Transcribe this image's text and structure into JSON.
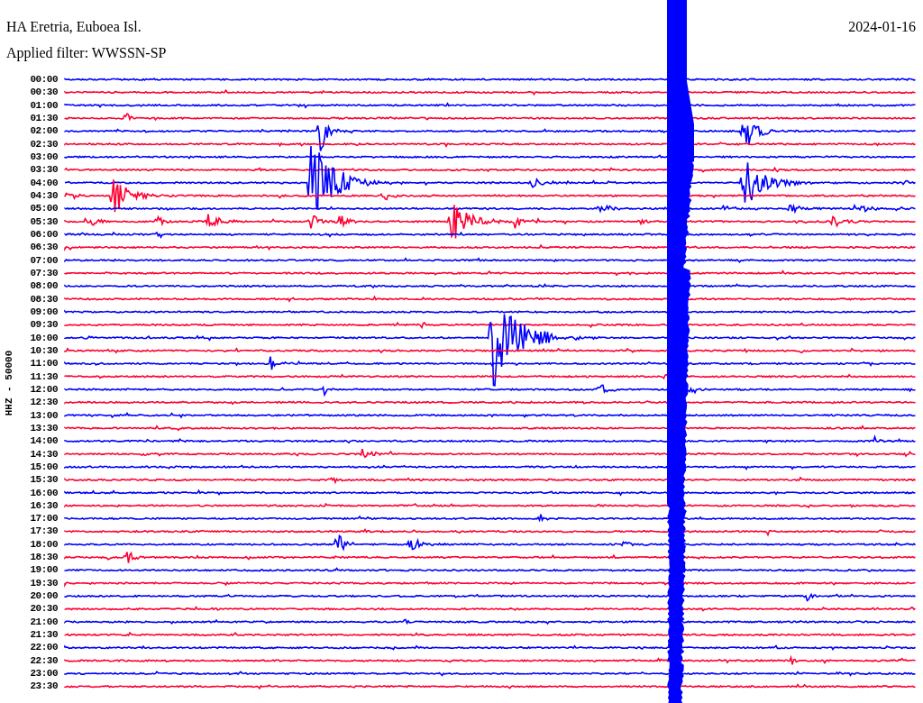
{
  "header": {
    "station": "HA Eretria, Euboea Isl.",
    "date": "2024-01-16",
    "filter": "Applied filter: WWSSN-SP"
  },
  "helicorder": {
    "channel_label": "HHZ - 50000",
    "rows": [
      {
        "time": "00:00",
        "color": "#0000ff"
      },
      {
        "time": "00:30",
        "color": "#ff0033"
      },
      {
        "time": "01:00",
        "color": "#0000ff"
      },
      {
        "time": "01:30",
        "color": "#ff0033"
      },
      {
        "time": "02:00",
        "color": "#0000ff"
      },
      {
        "time": "02:30",
        "color": "#ff0033"
      },
      {
        "time": "03:00",
        "color": "#0000ff"
      },
      {
        "time": "03:30",
        "color": "#ff0033"
      },
      {
        "time": "04:00",
        "color": "#0000ff"
      },
      {
        "time": "04:30",
        "color": "#ff0033"
      },
      {
        "time": "05:00",
        "color": "#0000ff"
      },
      {
        "time": "05:30",
        "color": "#ff0033"
      },
      {
        "time": "06:00",
        "color": "#0000ff"
      },
      {
        "time": "06:30",
        "color": "#ff0033"
      },
      {
        "time": "07:00",
        "color": "#0000ff"
      },
      {
        "time": "07:30",
        "color": "#ff0033"
      },
      {
        "time": "08:00",
        "color": "#0000ff"
      },
      {
        "time": "08:30",
        "color": "#ff0033"
      },
      {
        "time": "09:00",
        "color": "#0000ff"
      },
      {
        "time": "09:30",
        "color": "#ff0033"
      },
      {
        "time": "10:00",
        "color": "#0000ff"
      },
      {
        "time": "10:30",
        "color": "#ff0033"
      },
      {
        "time": "11:00",
        "color": "#0000ff"
      },
      {
        "time": "11:30",
        "color": "#ff0033"
      },
      {
        "time": "12:00",
        "color": "#0000ff"
      },
      {
        "time": "12:30",
        "color": "#ff0033"
      },
      {
        "time": "13:00",
        "color": "#0000ff"
      },
      {
        "time": "13:30",
        "color": "#ff0033"
      },
      {
        "time": "14:00",
        "color": "#0000ff"
      },
      {
        "time": "14:30",
        "color": "#ff0033"
      },
      {
        "time": "15:00",
        "color": "#0000ff"
      },
      {
        "time": "15:30",
        "color": "#ff0033"
      },
      {
        "time": "16:00",
        "color": "#0000ff"
      },
      {
        "time": "16:30",
        "color": "#ff0033"
      },
      {
        "time": "17:00",
        "color": "#0000ff"
      },
      {
        "time": "17:30",
        "color": "#ff0033"
      },
      {
        "time": "18:00",
        "color": "#0000ff"
      },
      {
        "time": "18:30",
        "color": "#ff0033"
      },
      {
        "time": "19:00",
        "color": "#0000ff"
      },
      {
        "time": "19:30",
        "color": "#ff0033"
      },
      {
        "time": "20:00",
        "color": "#0000ff"
      },
      {
        "time": "20:30",
        "color": "#ff0033"
      },
      {
        "time": "21:00",
        "color": "#0000ff"
      },
      {
        "time": "21:30",
        "color": "#ff0033"
      },
      {
        "time": "22:00",
        "color": "#0000ff"
      },
      {
        "time": "22:30",
        "color": "#ff0033"
      },
      {
        "time": "23:00",
        "color": "#0000ff"
      },
      {
        "time": "23:30",
        "color": "#ff0033"
      }
    ]
  }
}
